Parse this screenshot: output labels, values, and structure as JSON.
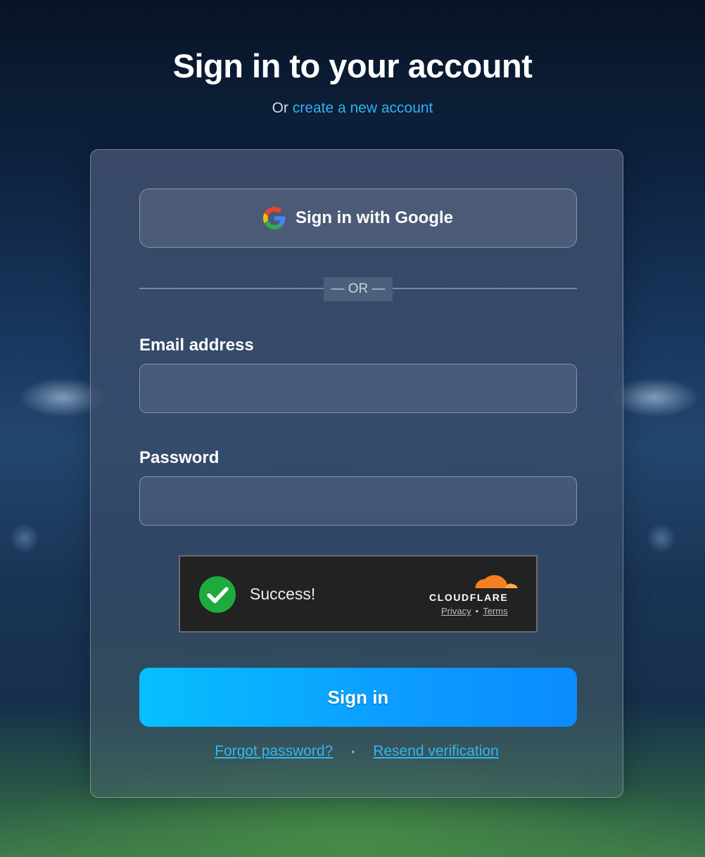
{
  "header": {
    "title": "Sign in to your account",
    "subtitle_prefix": "Or",
    "create_account_link": "create a new account"
  },
  "google_button": {
    "label": "Sign in with Google",
    "icon": "google-icon"
  },
  "divider": {
    "text": "— OR —"
  },
  "email": {
    "label": "Email address",
    "value": "",
    "placeholder": ""
  },
  "password": {
    "label": "Password",
    "value": "",
    "placeholder": ""
  },
  "captcha": {
    "status_text": "Success!",
    "status_icon": "check-circle-icon",
    "brand": "CLOUDFLARE",
    "privacy_link": "Privacy",
    "separator": "•",
    "terms_link": "Terms",
    "brand_color": "#f48120",
    "success_color": "#1eab3c"
  },
  "signin_button": {
    "label": "Sign in"
  },
  "footer_links": {
    "forgot_password": "Forgot password?",
    "separator": "•",
    "resend_verification": "Resend verification"
  },
  "colors": {
    "accent": "#0c9cff",
    "link": "#2fb1f2"
  }
}
